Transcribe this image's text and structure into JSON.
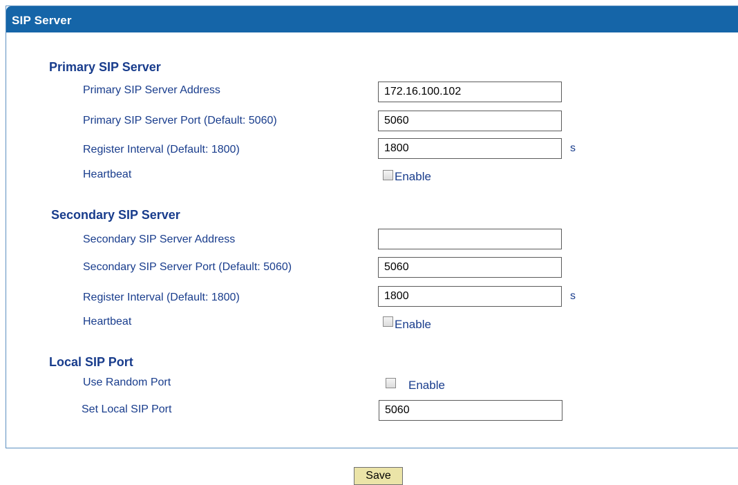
{
  "panel": {
    "title": "SIP Server"
  },
  "primary": {
    "heading": "Primary SIP Server",
    "address_label": "Primary SIP Server Address",
    "address_value": "172.16.100.102",
    "port_label": "Primary SIP Server Port (Default: 5060)",
    "port_value": "5060",
    "interval_label": "Register Interval (Default: 1800)",
    "interval_value": "1800",
    "interval_unit": "s",
    "heartbeat_label": "Heartbeat",
    "heartbeat_checkbox_label": "Enable",
    "heartbeat_checked": false
  },
  "secondary": {
    "heading": "Secondary SIP Server",
    "address_label": "Secondary SIP Server Address",
    "address_value": "",
    "port_label": "Secondary SIP Server Port (Default: 5060)",
    "port_value": "5060",
    "interval_label": "Register Interval (Default: 1800)",
    "interval_value": "1800",
    "interval_unit": "s",
    "heartbeat_label": "Heartbeat",
    "heartbeat_checkbox_label": "Enable",
    "heartbeat_checked": false
  },
  "local": {
    "heading": "Local SIP Port",
    "random_port_label": "Use Random Port",
    "random_port_checkbox_label": "Enable",
    "random_port_checked": false,
    "set_port_label": "Set Local SIP Port",
    "set_port_value": "5060"
  },
  "actions": {
    "save_label": "Save"
  }
}
